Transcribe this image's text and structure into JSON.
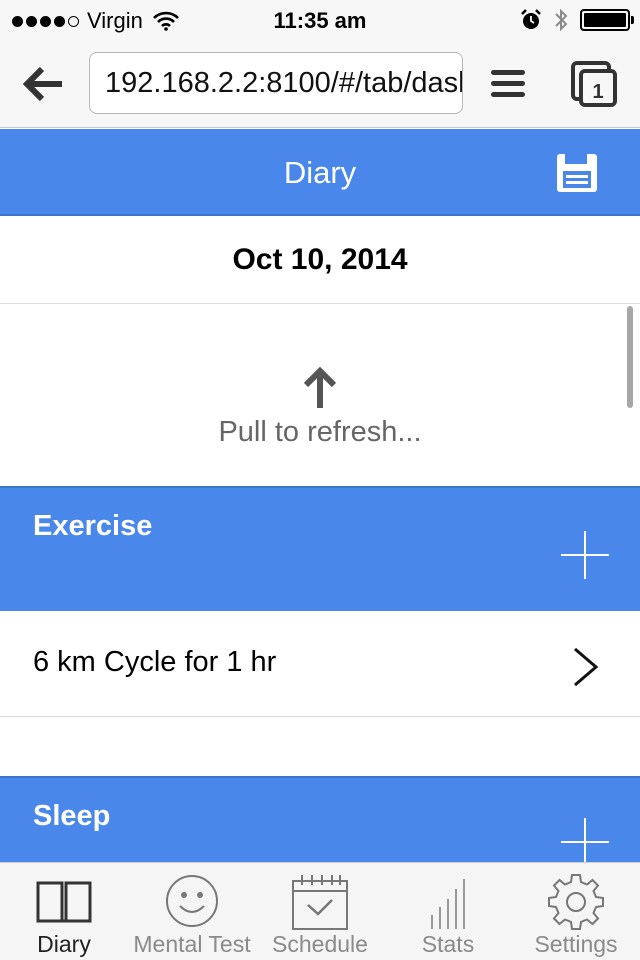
{
  "status_bar": {
    "carrier": "Virgin",
    "signal_bars": 4,
    "signal_bars_total": 5,
    "time": "11:35 am",
    "battery_level": 1.0,
    "icons": [
      "wifi-icon",
      "alarm-icon",
      "bluetooth-icon",
      "battery-icon"
    ]
  },
  "browser": {
    "url": "192.168.2.2:8100/#/tab/dash",
    "tab_count": "1",
    "icons": [
      "back-arrow-icon",
      "hamburger-menu-icon",
      "tabs-icon"
    ]
  },
  "header": {
    "title": "Diary",
    "save_icon": "floppy-disk-icon"
  },
  "date": "Oct 10, 2014",
  "refresh": {
    "text": "Pull to refresh...",
    "icon": "arrow-up-icon"
  },
  "sections": [
    {
      "title": "Exercise",
      "items": [
        {
          "text": "6 km Cycle for 1 hr"
        }
      ]
    },
    {
      "title": "Sleep",
      "items": []
    }
  ],
  "tabs": [
    {
      "label": "Diary",
      "icon": "book-icon",
      "active": true
    },
    {
      "label": "Mental Test",
      "icon": "smiley-icon",
      "active": false
    },
    {
      "label": "Schedule",
      "icon": "calendar-icon",
      "active": false
    },
    {
      "label": "Stats",
      "icon": "bar-chart-icon",
      "active": false
    },
    {
      "label": "Settings",
      "icon": "gear-icon",
      "active": false
    }
  ],
  "colors": {
    "accent": "#4a87ea",
    "tab_active": "#222222",
    "tab_inactive": "#8a8a8a"
  }
}
